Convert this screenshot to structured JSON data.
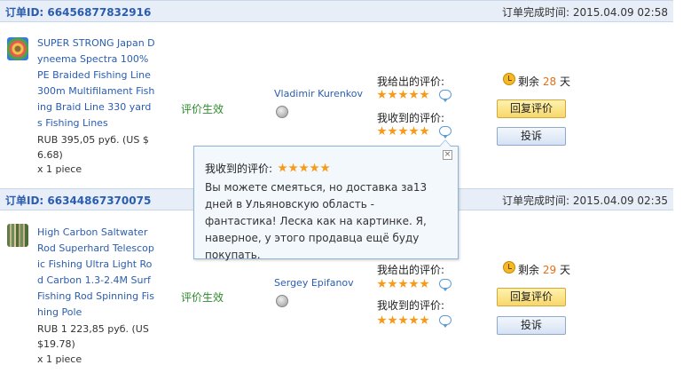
{
  "orders": [
    {
      "id_label": "订单ID: 66456877832916",
      "time_label": "订单完成时间:",
      "time": "2015.04.09 02:58",
      "product_title": "SUPER STRONG Japan Dyneema Spectra 100% PE Braided Fishing Line 300m Multifilament Fishing Braid Line 330 yards Fishing Lines",
      "price": "RUB 395,05 руб. (US $ 6.68)",
      "qty": "x 1 piece",
      "status": "评价生效",
      "buyer": "Vladimir Kurenkov",
      "given_label": "我给出的评价:",
      "received_label": "我收到的评价:",
      "remain_prefix": "剩余",
      "remain_days": "28",
      "remain_suffix": "天",
      "reply_btn": "回复评价",
      "complain_btn": "投诉"
    },
    {
      "id_label": "订单ID: 66344867370075",
      "time_label": "订单完成时间:",
      "time": "2015.04.09 02:35",
      "product_title": "High Carbon Saltwater Rod Superhard Telescopic Fishing Ultra Light Rod Carbon 1.3-2.4M Surf Fishing Rod Spinning Fishing Pole",
      "price": "RUB 1 223,85 руб. (US $19.78)",
      "qty": "x 1 piece",
      "status": "评价生效",
      "buyer": "Sergey Epifanov",
      "given_label": "我给出的评价:",
      "received_label": "我收到的评价:",
      "remain_prefix": "剩余",
      "remain_days": "29",
      "remain_suffix": "天",
      "reply_btn": "回复评价",
      "complain_btn": "投诉"
    }
  ],
  "popup": {
    "title": "我收到的评价:",
    "body": "Вы можете смеяться, но доставка за13 дней в Ульяновскую область - фантастика! Леска как на картинке. Я, наверное, у этого продавца ещё буду покупать.",
    "close": "×"
  },
  "colors": {
    "link": "#2a5db0",
    "status": "#2e8b2e",
    "star": "#f79a1b",
    "days": "#e0701b"
  },
  "icons": [
    "star-icon",
    "comment-bubble-icon",
    "clock-icon",
    "buyer-avatar-icon",
    "close-icon"
  ]
}
